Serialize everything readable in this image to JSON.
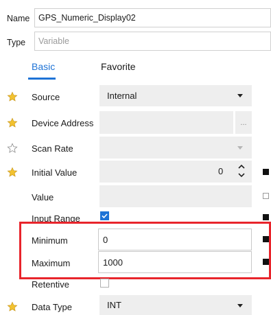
{
  "header": {
    "name_label": "Name",
    "name_value": "GPS_Numeric_Display02",
    "type_label": "Type",
    "type_placeholder": "Variable"
  },
  "tabs": [
    {
      "label": "Basic",
      "active": true
    },
    {
      "label": "Favorite",
      "active": false
    }
  ],
  "rows": {
    "source": {
      "label": "Source",
      "value": "Internal",
      "starred": true
    },
    "device_address": {
      "label": "Device Address",
      "value": "",
      "button": "...",
      "starred": true
    },
    "scan_rate": {
      "label": "Scan Rate",
      "value": "",
      "starred": false
    },
    "initial_value": {
      "label": "Initial Value",
      "value": "0",
      "starred": true
    },
    "value": {
      "label": "Value",
      "value": ""
    },
    "input_range": {
      "label": "Input Range",
      "checked": true
    },
    "minimum": {
      "label": "Minimum",
      "value": "0"
    },
    "maximum": {
      "label": "Maximum",
      "value": "1000"
    },
    "retentive": {
      "label": "Retentive",
      "checked": false
    },
    "data_type": {
      "label": "Data Type",
      "value": "INT",
      "starred": true
    }
  },
  "colors": {
    "accent": "#1e73d6",
    "star": "#f2c230",
    "highlight": "#e8242b"
  }
}
